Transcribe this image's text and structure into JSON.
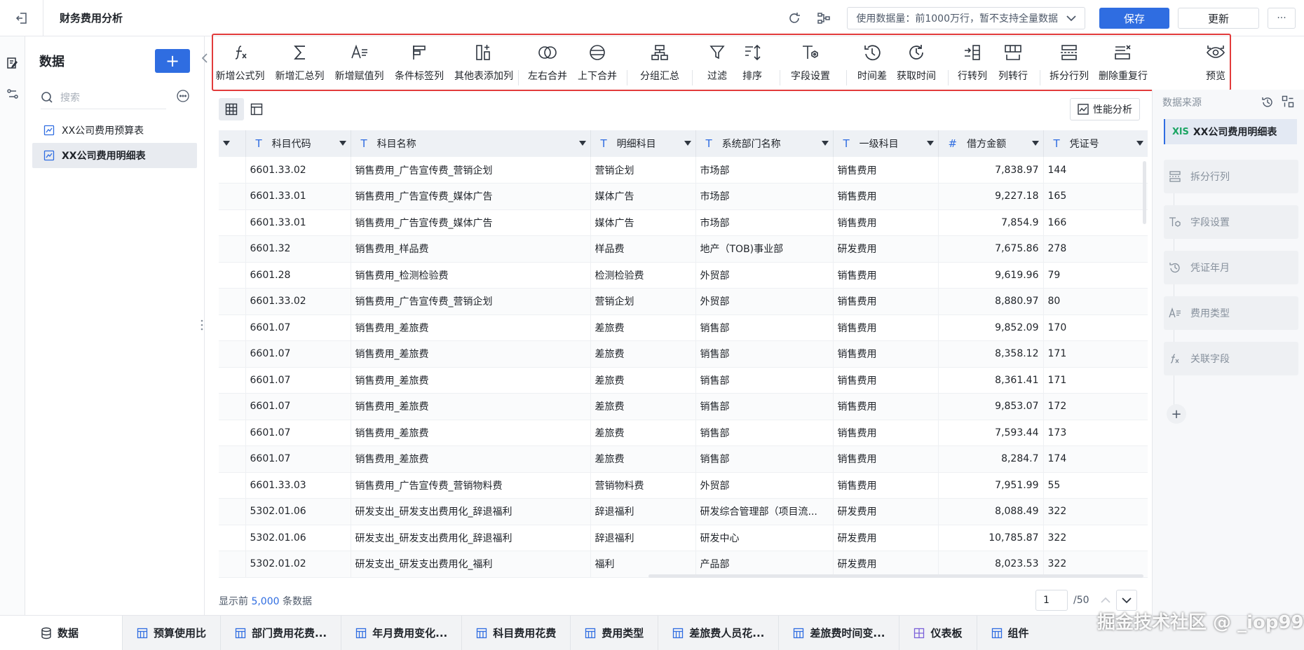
{
  "app": {
    "title": "财务费用分析"
  },
  "topbar": {
    "limit_text": "使用数据量：前1000万行，暂不支持全量数据",
    "save_label": "保存",
    "update_label": "更新",
    "more_label": "···"
  },
  "datapanel": {
    "title": "数据",
    "add_label": "+",
    "search_placeholder": "搜索",
    "items": [
      {
        "label": "XX公司费用预算表"
      },
      {
        "label": "XX公司费用明细表"
      }
    ]
  },
  "toolbar": {
    "items": [
      {
        "label": "新增公式列",
        "icon": "formula-icon"
      },
      {
        "label": "新增汇总列",
        "icon": "sigma-icon"
      },
      {
        "label": "新增赋值列",
        "icon": "assign-icon"
      },
      {
        "label": "条件标签列",
        "icon": "flag-icon"
      },
      {
        "label": "其他表添加列",
        "icon": "add-column-icon"
      },
      {
        "label": "左右合并",
        "icon": "merge-lr-icon"
      },
      {
        "label": "上下合并",
        "icon": "merge-ud-icon"
      },
      {
        "label": "分组汇总",
        "icon": "group-icon"
      },
      {
        "label": "过滤",
        "icon": "filter-icon"
      },
      {
        "label": "排序",
        "icon": "sort-icon"
      },
      {
        "label": "字段设置",
        "icon": "field-settings-icon"
      },
      {
        "label": "时间差",
        "icon": "time-diff-icon"
      },
      {
        "label": "获取时间",
        "icon": "get-time-icon"
      },
      {
        "label": "行转列",
        "icon": "row-to-col-icon"
      },
      {
        "label": "列转行",
        "icon": "col-to-row-icon"
      },
      {
        "label": "拆分行列",
        "icon": "split-icon"
      },
      {
        "label": "删除重复行",
        "icon": "dedupe-icon"
      }
    ],
    "preview_label": "预览"
  },
  "perf_label": "性能分析",
  "table": {
    "columns": [
      {
        "label": "科目代码",
        "type": "T"
      },
      {
        "label": "科目名称",
        "type": "T"
      },
      {
        "label": "明细科目",
        "type": "T"
      },
      {
        "label": "系统部门名称",
        "type": "T"
      },
      {
        "label": "一级科目",
        "type": "T"
      },
      {
        "label": "借方金额",
        "type": "#"
      },
      {
        "label": "凭证号",
        "type": "T"
      }
    ],
    "rows": [
      [
        "6601.33.02",
        "销售费用_广告宣传费_营销企划",
        "营销企划",
        "市场部",
        "销售费用",
        "7,838.97",
        "144"
      ],
      [
        "6601.33.01",
        "销售费用_广告宣传费_媒体广告",
        "媒体广告",
        "市场部",
        "销售费用",
        "9,227.18",
        "165"
      ],
      [
        "6601.33.01",
        "销售费用_广告宣传费_媒体广告",
        "媒体广告",
        "市场部",
        "销售费用",
        "7,854.9",
        "166"
      ],
      [
        "6601.32",
        "销售费用_样品费",
        "样品费",
        "地产（TOB)事业部",
        "研发费用",
        "7,675.86",
        "278"
      ],
      [
        "6601.28",
        "销售费用_检测检验费",
        "检测检验费",
        "外贸部",
        "销售费用",
        "9,619.96",
        "79"
      ],
      [
        "6601.33.02",
        "销售费用_广告宣传费_营销企划",
        "营销企划",
        "外贸部",
        "销售费用",
        "8,880.97",
        "80"
      ],
      [
        "6601.07",
        "销售费用_差旅费",
        "差旅费",
        "销售部",
        "销售费用",
        "9,852.09",
        "170"
      ],
      [
        "6601.07",
        "销售费用_差旅费",
        "差旅费",
        "销售部",
        "销售费用",
        "8,358.12",
        "171"
      ],
      [
        "6601.07",
        "销售费用_差旅费",
        "差旅费",
        "销售部",
        "销售费用",
        "8,361.41",
        "171"
      ],
      [
        "6601.07",
        "销售费用_差旅费",
        "差旅费",
        "销售部",
        "销售费用",
        "9,853.07",
        "172"
      ],
      [
        "6601.07",
        "销售费用_差旅费",
        "差旅费",
        "销售部",
        "销售费用",
        "7,593.44",
        "173"
      ],
      [
        "6601.07",
        "销售费用_差旅费",
        "差旅费",
        "销售部",
        "销售费用",
        "8,284.7",
        "174"
      ],
      [
        "6601.33.03",
        "销售费用_广告宣传费_营销物料费",
        "营销物料费",
        "外贸部",
        "销售费用",
        "7,951.99",
        "55"
      ],
      [
        "5302.01.06",
        "研发支出_研发支出费用化_辞退福利",
        "辞退福利",
        "研发综合管理部（项目流...",
        "研发费用",
        "8,088.49",
        "322"
      ],
      [
        "5302.01.06",
        "研发支出_研发支出费用化_辞退福利",
        "辞退福利",
        "研发中心",
        "研发费用",
        "10,785.87",
        "322"
      ],
      [
        "5302.01.02",
        "研发支出_研发支出费用化_福利",
        "福利",
        "产品部",
        "研发费用",
        "8,023.53",
        "322"
      ]
    ]
  },
  "footer": {
    "prefix": "显示前",
    "count": "5,000",
    "suffix": "条数据",
    "page": "1",
    "total_pages": "/50"
  },
  "rightpanel": {
    "title": "数据来源",
    "source_tag": "XlS",
    "source": "XX公司费用明细表",
    "steps": [
      {
        "label": "拆分行列",
        "icon": "split-icon"
      },
      {
        "label": "字段设置",
        "icon": "field-settings-icon"
      },
      {
        "label": "凭证年月",
        "icon": "time-diff-icon"
      },
      {
        "label": "费用类型",
        "icon": "assign-icon"
      },
      {
        "label": "关联字段",
        "icon": "formula-icon"
      }
    ],
    "add_label": "+"
  },
  "bottom_tabs": [
    {
      "label": "数据",
      "icon": "database-icon"
    },
    {
      "label": "预算使用比",
      "icon": "table-icon"
    },
    {
      "label": "部门费用花费...",
      "icon": "table-icon"
    },
    {
      "label": "年月费用变化...",
      "icon": "table-icon"
    },
    {
      "label": "科目费用花费",
      "icon": "table-icon"
    },
    {
      "label": "费用类型",
      "icon": "table-icon"
    },
    {
      "label": "差旅费人员花...",
      "icon": "table-icon"
    },
    {
      "label": "差旅费时间变...",
      "icon": "table-icon"
    },
    {
      "label": "仪表板",
      "icon": "dashboard-icon"
    },
    {
      "label": "组件",
      "icon": "table-icon"
    }
  ],
  "watermark": "掘金技术社区 @ _iop99"
}
